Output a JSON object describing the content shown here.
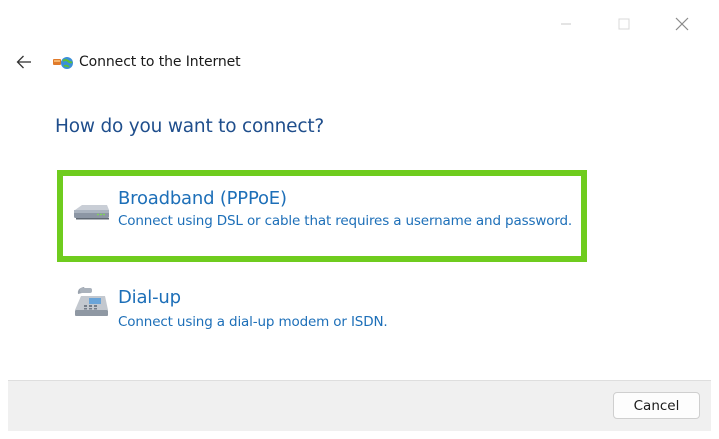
{
  "window": {
    "title": "Connect to the Internet",
    "controls": {
      "minimize_icon": "minimize-icon",
      "maximize_icon": "maximize-icon",
      "close_icon": "close-icon"
    }
  },
  "header": {
    "back_icon": "arrow-left-icon",
    "app_icon": "network-globe-icon",
    "title": "Connect to the Internet"
  },
  "main": {
    "heading": "How do you want to connect?",
    "options": [
      {
        "title": "Broadband (PPPoE)",
        "description": "Connect using DSL or cable that requires a username and password.",
        "icon": "modem-icon",
        "highlighted": true
      },
      {
        "title": "Dial-up",
        "description": "Connect using a dial-up modem or ISDN.",
        "icon": "telephone-icon",
        "highlighted": false
      }
    ]
  },
  "footer": {
    "cancel_label": "Cancel"
  },
  "colors": {
    "heading": "#1f4e8c",
    "link": "#1d6fb8",
    "highlight_border": "#6fcc1e",
    "footer_bg": "#f0f0f0"
  }
}
